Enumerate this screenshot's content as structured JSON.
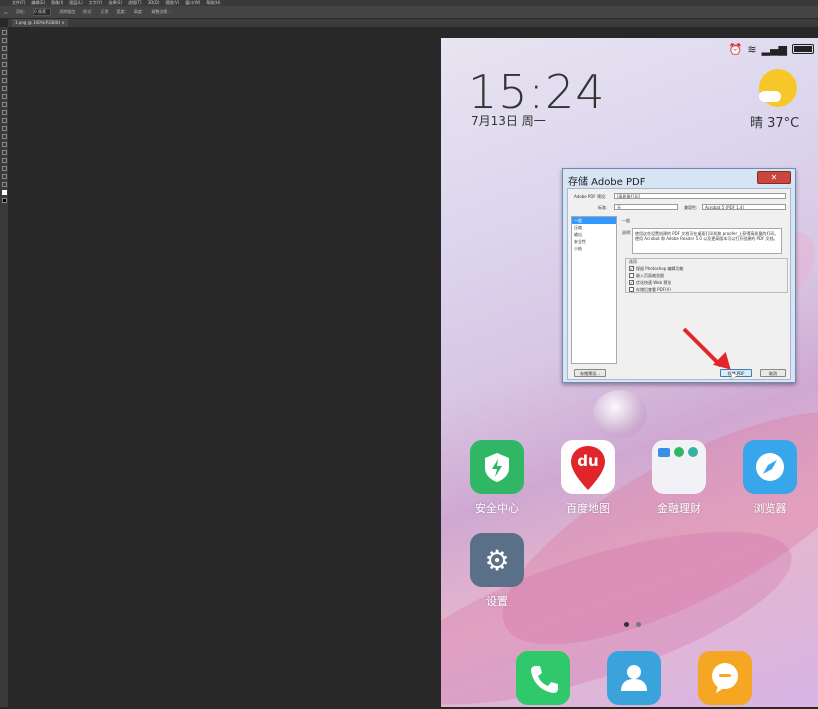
{
  "photoshop": {
    "menu_items": [
      "文件(F)",
      "编辑(E)",
      "图像(I)",
      "图层(L)",
      "文字(Y)",
      "选择(S)",
      "滤镜(T)",
      "3D(D)",
      "视图(V)",
      "窗口(W)",
      "帮助(H)"
    ],
    "options": [
      "羽化:",
      "0 像素",
      "消除锯齿",
      "样式:",
      "正常",
      "宽度:",
      "高度:",
      "调整边缘..."
    ],
    "document_tab": "1.png @ 100%(RGB/8) ×"
  },
  "phone": {
    "time": "15:24",
    "date": "7月13日 周一",
    "weather": "晴  37°C",
    "apps": [
      {
        "label": "安全中心",
        "icon": "shield-bolt-icon",
        "color": "#2fb765"
      },
      {
        "label": "百度地图",
        "icon": "baidu-map-icon",
        "color": "#ffffff"
      },
      {
        "label": "金融理财",
        "icon": "finance-icon",
        "color": "#f2f2f6"
      },
      {
        "label": "浏览器",
        "icon": "browser-icon",
        "color": "#37a6ea"
      },
      {
        "label": "设置",
        "icon": "gear-icon",
        "color": "#5a6f88"
      }
    ],
    "dock": [
      {
        "icon": "phone-icon",
        "color": "#2fc86a"
      },
      {
        "icon": "contacts-icon",
        "color": "#3aa3dc"
      },
      {
        "icon": "messages-icon",
        "color": "#f5a623"
      }
    ],
    "baidu_glyph": "du"
  },
  "dialog": {
    "title": "存储 Adobe PDF",
    "close": "✕",
    "preset_label": "Adobe PDF 预设:",
    "preset_value": "[高质量打印]",
    "standard_label": "标准:",
    "standard_value": "无",
    "compat_label": "兼容性:",
    "compat_value": "Acrobat 5 (PDF 1.4)",
    "sections": [
      "一般",
      "压缩",
      "输出",
      "安全性",
      "小结"
    ],
    "section_heading": "一般",
    "desc_label": "说明:",
    "description": "使用这些设置创建的 PDF 文档可在桌面打印机和 proofer 上获得高质量的打印。使用 Acrobat 和 Adobe Reader 5.0 以及更高版本可以打开创建的 PDF 文档。",
    "options_heading": "选项",
    "checkboxes": [
      {
        "label": "保留 Photoshop 编辑功能",
        "checked": "✓"
      },
      {
        "label": "嵌入页面缩览图",
        "checked": ""
      },
      {
        "label": "优化快速 Web 预览",
        "checked": "✓"
      },
      {
        "label": "存储后查看 PDF(V)",
        "checked": ""
      }
    ],
    "save_preset_button": "存储预设...",
    "save_pdf_button": "存储 PDF",
    "cancel_button": "取消"
  }
}
